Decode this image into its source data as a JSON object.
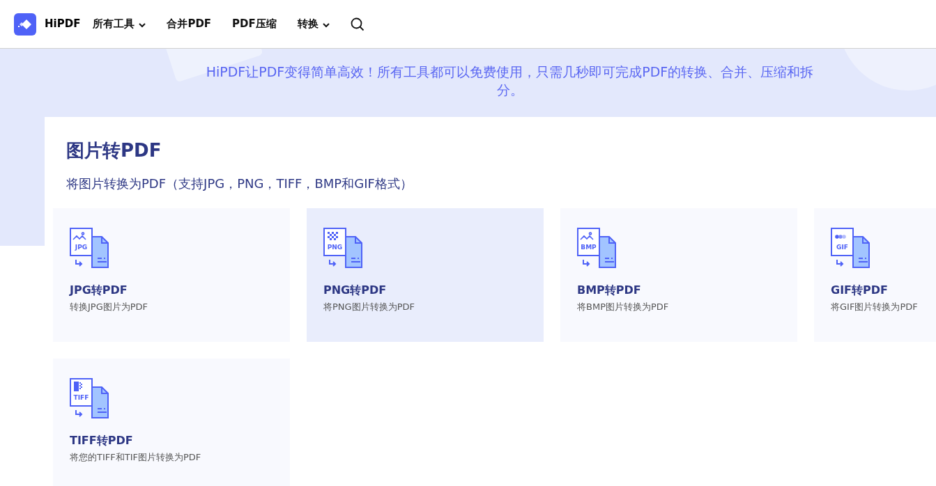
{
  "header": {
    "brand": "HiPDF",
    "nav": [
      {
        "label": "所有工具",
        "dropdown": true
      },
      {
        "label": "合并PDF",
        "dropdown": false
      },
      {
        "label": "PDF压缩",
        "dropdown": false
      },
      {
        "label": "转换",
        "dropdown": true
      }
    ]
  },
  "hero": {
    "subtitle": "HiPDF让PDF变得简单高效！所有工具都可以免费使用，只需几秒即可完成PDF的转换、合并、压缩和拆分。"
  },
  "section": {
    "title": "图片转PDF",
    "description": "将图片转换为PDF（支持JPG，PNG，TIFF，BMP和GIF格式）"
  },
  "tools": [
    {
      "kind": "photo",
      "icon_label": "JPG",
      "title": "JPG转PDF",
      "description": "转换JPG图片为PDF",
      "selected": false
    },
    {
      "kind": "checker",
      "icon_label": "PNG",
      "title": "PNG转PDF",
      "description": "将PNG图片转换为PDF",
      "selected": true
    },
    {
      "kind": "photo",
      "icon_label": "BMP",
      "title": "BMP转PDF",
      "description": "将BMP图片转换为PDF",
      "selected": false
    },
    {
      "kind": "dots",
      "icon_label": "GIF",
      "title": "GIF转PDF",
      "description": "将GIF图片转换为PDF",
      "selected": false
    },
    {
      "kind": "bars",
      "icon_label": "TIFF",
      "title": "TIFF转PDF",
      "description": "将您的TIFF和TIF图片转换为PDF",
      "selected": false
    }
  ]
}
